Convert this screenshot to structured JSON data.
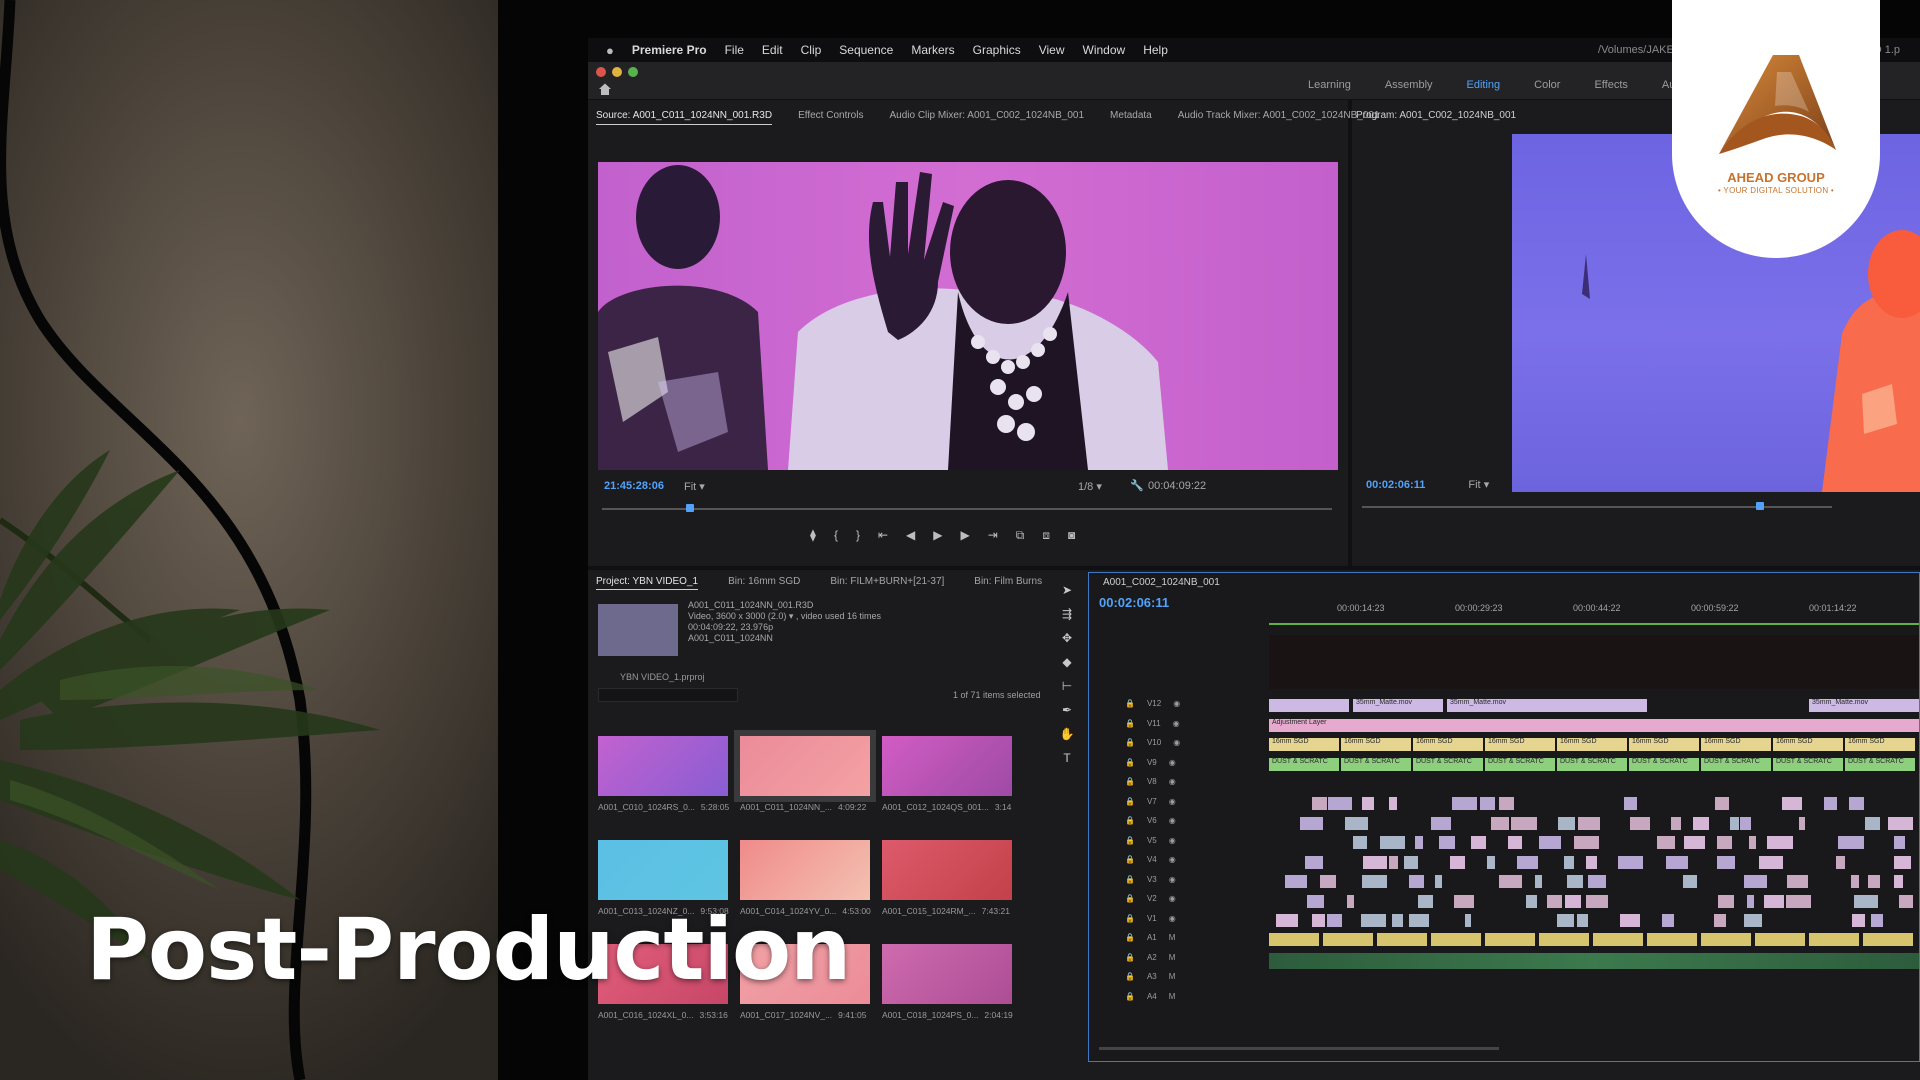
{
  "overlay": {
    "title": "Post-Production"
  },
  "logo": {
    "brand": "AHEAD GROUP",
    "tagline": "• YOUR DIGITAL SOLUTION •",
    "brand_color": "#c7732e"
  },
  "menubar": {
    "app": "Premiere Pro",
    "items": [
      "File",
      "Edit",
      "Clip",
      "Sequence",
      "Markers",
      "Graphics",
      "View",
      "Window",
      "Help"
    ],
    "path": "/Volumes/JAKES DROBO/Premiere Pro Files/YBN VIDEO 1.p"
  },
  "workspaces": {
    "items": [
      "Learning",
      "Assembly",
      "Editing",
      "Color",
      "Effects",
      "Audio"
    ],
    "active": "Editing"
  },
  "source_monitor": {
    "tabs": [
      "Source: A001_C011_1024NN_001.R3D",
      "Effect Controls",
      "Audio Clip Mixer: A001_C002_1024NB_001",
      "Metadata",
      "Audio Track Mixer: A001_C002_1024NB_001"
    ],
    "timecode": "21:45:28:06",
    "fit": "Fit",
    "resolution": "1/8",
    "duration": "00:04:09:22"
  },
  "program_monitor": {
    "tab": "Program: A001_C002_1024NB_001",
    "timecode": "00:02:06:11",
    "fit": "Fit"
  },
  "project_panel": {
    "tabs": [
      "Project: YBN VIDEO_1",
      "Bin: 16mm SGD",
      "Bin: FILM+BURN+[21-37]",
      "Bin: Film Burns"
    ],
    "clip_name": "A001_C011_1024NN_001.R3D",
    "clip_info": [
      "Video, 3600 x 3000 (2.0) ▾ , video used 16 times",
      "00:04:09:22, 23.976p",
      "A001_C011_1024NN"
    ],
    "file": "YBN VIDEO_1.prproj",
    "count": "1 of 71 items selected",
    "thumbnails": [
      {
        "label": "A001_C010_1024RS_0...",
        "duration": "5:28:05"
      },
      {
        "label": "A001_C011_1024NN_...",
        "duration": "4:09:22"
      },
      {
        "label": "A001_C012_1024QS_001...",
        "duration": "3:14"
      },
      {
        "label": "A001_C013_1024NZ_0...",
        "duration": "9:53:08"
      },
      {
        "label": "A001_C014_1024YV_0...",
        "duration": "4:53:00"
      },
      {
        "label": "A001_C015_1024RM_...",
        "duration": "7:43:21"
      },
      {
        "label": "A001_C016_1024XL_0...",
        "duration": "3:53:16"
      },
      {
        "label": "A001_C017_1024NV_...",
        "duration": "9:41:05"
      },
      {
        "label": "A001_C018_1024PS_0...",
        "duration": "2:04:19"
      }
    ]
  },
  "timeline": {
    "tab": "A001_C002_1024NB_001",
    "timecode": "00:02:06:11",
    "ruler": [
      "00:00:14:23",
      "00:00:29:23",
      "00:00:44:22",
      "00:00:59:22",
      "00:01:14:22"
    ],
    "tracks": [
      "V12",
      "V11",
      "V10",
      "V9",
      "V8",
      "V7",
      "V6",
      "V5",
      "V4",
      "V3",
      "V2",
      "V1",
      "A1",
      "A2",
      "A3",
      "A4"
    ],
    "clip_labels": {
      "v12": [
        "35mm_Matte.mov",
        "35mm_Matte.mov",
        "35mm_Matte.mov"
      ],
      "v11": "Adjustment Layer",
      "v10": "16mm SGD",
      "v9": "DUST & SCRATC"
    }
  }
}
